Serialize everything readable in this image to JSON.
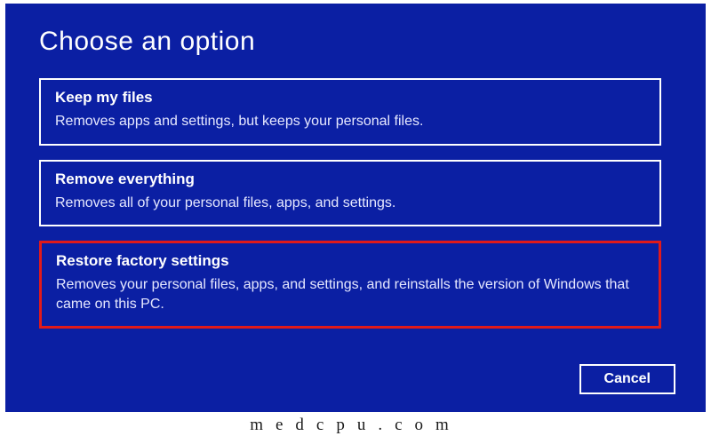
{
  "title": "Choose an option",
  "options": [
    {
      "title": "Keep my files",
      "desc": "Removes apps and settings, but keeps your personal files.",
      "highlight": false
    },
    {
      "title": "Remove everything",
      "desc": "Removes all of your personal files, apps, and settings.",
      "highlight": false
    },
    {
      "title": "Restore factory settings",
      "desc": "Removes your personal files, apps, and settings, and reinstalls the version of Windows that came on this PC.",
      "highlight": true
    }
  ],
  "cancel_label": "Cancel",
  "watermark": "medcpu.com"
}
